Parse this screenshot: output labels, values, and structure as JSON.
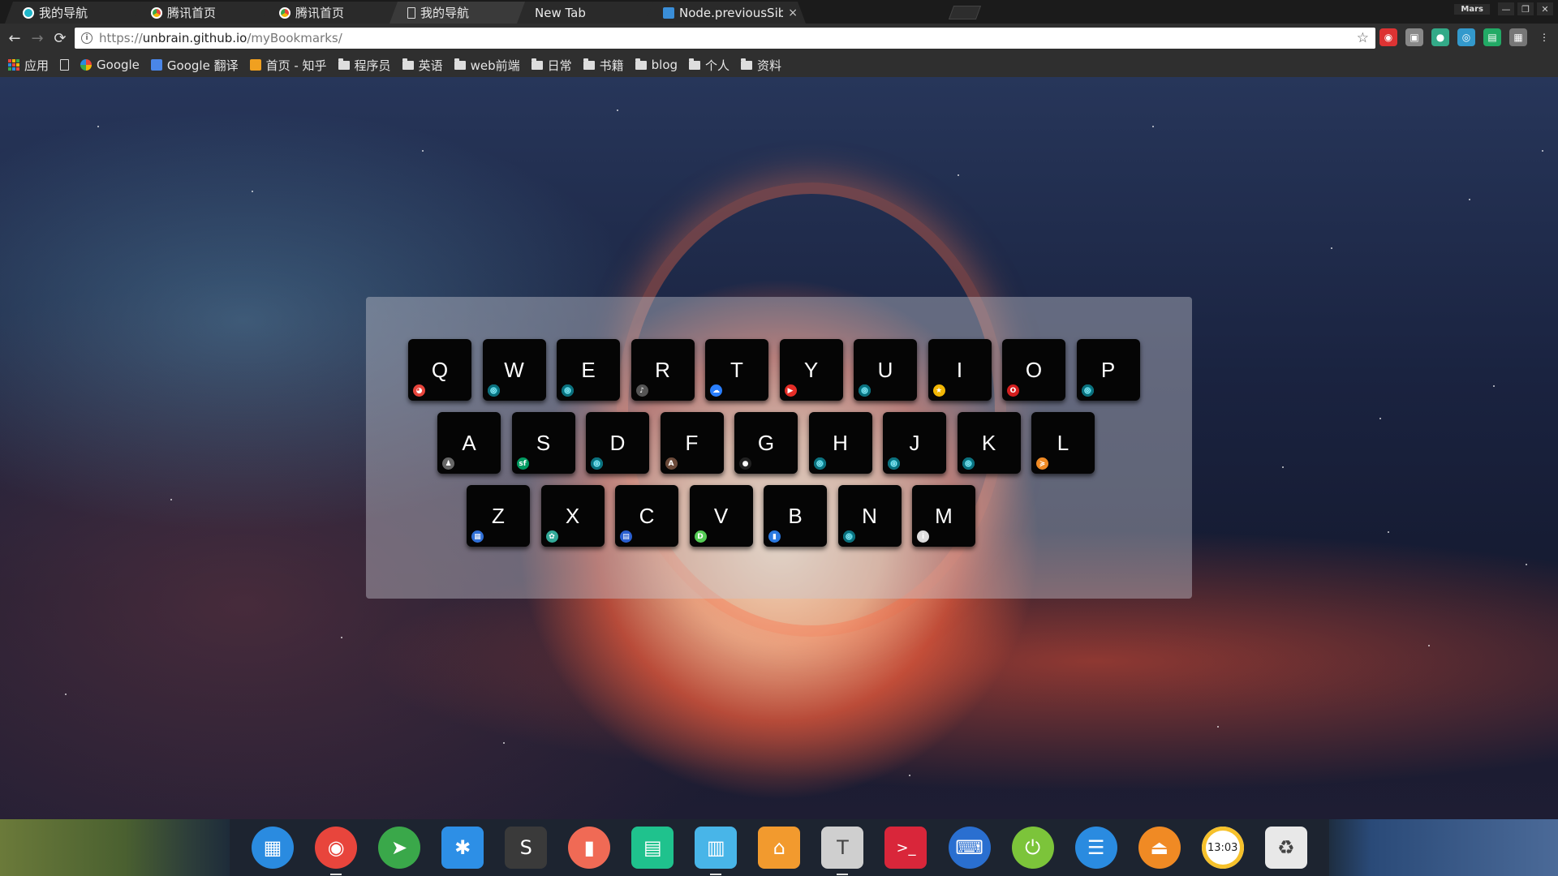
{
  "tabs": [
    {
      "title": "我的导航",
      "favicon": "circle-cyan",
      "active": false
    },
    {
      "title": "腾讯首页",
      "favicon": "chrome-colors",
      "active": false
    },
    {
      "title": "腾讯首页",
      "favicon": "chrome-colors",
      "active": false
    },
    {
      "title": "我的导航",
      "favicon": "page",
      "active": true
    },
    {
      "title": "New Tab",
      "favicon": "",
      "active": false
    },
    {
      "title": "Node.previousSibl",
      "favicon": "blue-square",
      "active": false
    }
  ],
  "window": {
    "user": "Mars",
    "minimize": "—",
    "restore": "❐",
    "close": "✕"
  },
  "nav": {
    "back": "←",
    "forward": "→",
    "reload": "⟳"
  },
  "address": {
    "scheme": "https://",
    "host": "unbrain.github.io",
    "path": "/myBookmarks/",
    "info": "i",
    "star": "☆"
  },
  "extensions": [
    {
      "name": "red-shield-icon",
      "color": "#d33",
      "glyph": "◉"
    },
    {
      "name": "image-ext-icon",
      "color": "#888",
      "glyph": "▣"
    },
    {
      "name": "green-dot-icon",
      "color": "#3a8",
      "glyph": "●"
    },
    {
      "name": "blue-circle-icon",
      "color": "#39c",
      "glyph": "◎"
    },
    {
      "name": "green-square-icon",
      "color": "#2a6",
      "glyph": "▤"
    },
    {
      "name": "gray-box-icon",
      "color": "#777",
      "glyph": "▦"
    },
    {
      "name": "menu-dots-icon",
      "color": "transparent",
      "glyph": "⋮"
    }
  ],
  "bookmarks": [
    {
      "label": "应用",
      "type": "apps"
    },
    {
      "label": "",
      "type": "page"
    },
    {
      "label": "Google",
      "type": "google"
    },
    {
      "label": "Google 翻译",
      "type": "translate"
    },
    {
      "label": "首页 - 知乎",
      "type": "zhihu"
    },
    {
      "label": "程序员",
      "type": "folder"
    },
    {
      "label": "英语",
      "type": "folder"
    },
    {
      "label": "web前端",
      "type": "folder"
    },
    {
      "label": "日常",
      "type": "folder"
    },
    {
      "label": "书籍",
      "type": "folder"
    },
    {
      "label": "blog",
      "type": "folder"
    },
    {
      "label": "个人",
      "type": "folder"
    },
    {
      "label": "资料",
      "type": "folder"
    }
  ],
  "keyboard": {
    "rows": [
      [
        {
          "letter": "Q",
          "icon": "chrome-icon",
          "color": "#e8453c",
          "glyph": "◕"
        },
        {
          "letter": "W",
          "icon": "cyan-globe-icon",
          "color": "#1fb6c9",
          "glyph": "◎"
        },
        {
          "letter": "E",
          "icon": "cyan-globe-icon",
          "color": "#1fb6c9",
          "glyph": "◎"
        },
        {
          "letter": "R",
          "icon": "note-icon",
          "color": "#555",
          "glyph": "♪"
        },
        {
          "letter": "T",
          "icon": "cloud-icon",
          "color": "#2a7fff",
          "glyph": "☁"
        },
        {
          "letter": "Y",
          "icon": "youtube-icon",
          "color": "#e52d27",
          "glyph": "▶"
        },
        {
          "letter": "U",
          "icon": "cyan-globe-icon",
          "color": "#1fb6c9",
          "glyph": "◎"
        },
        {
          "letter": "I",
          "icon": "yellow-app-icon",
          "color": "#f2b705",
          "glyph": "★"
        },
        {
          "letter": "O",
          "icon": "opera-icon",
          "color": "#d41e1e",
          "glyph": "O"
        },
        {
          "letter": "P",
          "icon": "cyan-globe-icon",
          "color": "#1fb6c9",
          "glyph": "◎"
        }
      ],
      [
        {
          "letter": "A",
          "icon": "qq-penguin-icon",
          "color": "#666",
          "glyph": "♟"
        },
        {
          "letter": "S",
          "icon": "segmentfault-icon",
          "color": "#009a61",
          "glyph": "sf"
        },
        {
          "letter": "D",
          "icon": "cyan-globe-icon",
          "color": "#1fb6c9",
          "glyph": "◎"
        },
        {
          "letter": "F",
          "icon": "framed-a-icon",
          "color": "#6b4a3a",
          "glyph": "A"
        },
        {
          "letter": "G",
          "icon": "github-icon",
          "color": "#222",
          "glyph": "●"
        },
        {
          "letter": "H",
          "icon": "cyan-globe-icon",
          "color": "#1fb6c9",
          "glyph": "◎"
        },
        {
          "letter": "J",
          "icon": "cyan-globe-icon",
          "color": "#1fb6c9",
          "glyph": "◎"
        },
        {
          "letter": "K",
          "icon": "cyan-globe-icon",
          "color": "#1fb6c9",
          "glyph": "◎"
        },
        {
          "letter": "L",
          "icon": "orange-arrow-icon",
          "color": "#f08a24",
          "glyph": "≽"
        }
      ],
      [
        {
          "letter": "Z",
          "icon": "blue-doc-icon",
          "color": "#2f6fd6",
          "glyph": "▦"
        },
        {
          "letter": "X",
          "icon": "colorful-grid-icon",
          "color": "#3a9",
          "glyph": "✿"
        },
        {
          "letter": "C",
          "icon": "blue-book-icon",
          "color": "#2a5fd0",
          "glyph": "▤"
        },
        {
          "letter": "V",
          "icon": "green-d-icon",
          "color": "#5c5",
          "glyph": "D"
        },
        {
          "letter": "B",
          "icon": "bookmark-icon",
          "color": "#2a79e0",
          "glyph": "▮"
        },
        {
          "letter": "N",
          "icon": "cyan-globe-icon",
          "color": "#1fb6c9",
          "glyph": "◎"
        },
        {
          "letter": "M",
          "icon": "white-i-icon",
          "color": "#ddd",
          "glyph": "i"
        }
      ]
    ]
  },
  "dock": [
    {
      "name": "launcher-icon",
      "color": "#2a8be0",
      "glyph": "▦",
      "shape": "round",
      "running": false
    },
    {
      "name": "chrome-icon",
      "color": "#e8453c",
      "glyph": "◉",
      "shape": "round",
      "running": true
    },
    {
      "name": "telegram-icon",
      "color": "#3aa84a",
      "glyph": "➤",
      "shape": "round",
      "running": false
    },
    {
      "name": "star-app-icon",
      "color": "#2d8fe6",
      "glyph": "✱",
      "shape": "sq",
      "running": false
    },
    {
      "name": "sublime-icon",
      "color": "#3a3a3a",
      "glyph": "S",
      "shape": "sq",
      "running": false
    },
    {
      "name": "screen-record-icon",
      "color": "#f06a55",
      "glyph": "▮",
      "shape": "round",
      "running": false
    },
    {
      "name": "terminal-green-icon",
      "color": "#1fc28d",
      "glyph": "▤",
      "shape": "sq",
      "running": false
    },
    {
      "name": "file-manager-icon",
      "color": "#48b5e8",
      "glyph": "▥",
      "shape": "sq",
      "running": true
    },
    {
      "name": "store-icon",
      "color": "#f29a2e",
      "glyph": "⌂",
      "shape": "sq",
      "running": false
    },
    {
      "name": "text-editor-icon",
      "color": "#cfcfcf",
      "glyph": "T",
      "shape": "sq",
      "running": true
    },
    {
      "name": "terminal-icon",
      "color": "#d9263a",
      "glyph": ">_",
      "shape": "sq",
      "running": false
    },
    {
      "name": "keyboard-app-icon",
      "color": "#2a6fd0",
      "glyph": "⌨",
      "shape": "round",
      "running": false
    },
    {
      "name": "green-plug-icon",
      "color": "#7cc43a",
      "glyph": "⏻",
      "shape": "round",
      "running": false
    },
    {
      "name": "wifi-icon",
      "color": "#2a8be0",
      "glyph": "☰",
      "shape": "round",
      "running": false
    },
    {
      "name": "eject-icon",
      "color": "#f08a24",
      "glyph": "⏏",
      "shape": "round",
      "running": false
    },
    {
      "name": "clock-icon",
      "color": "#f6c12b",
      "glyph": "13:03",
      "shape": "round",
      "running": false
    },
    {
      "name": "trash-icon",
      "color": "#e8e8e8",
      "glyph": "♻",
      "shape": "sq",
      "running": false
    }
  ]
}
